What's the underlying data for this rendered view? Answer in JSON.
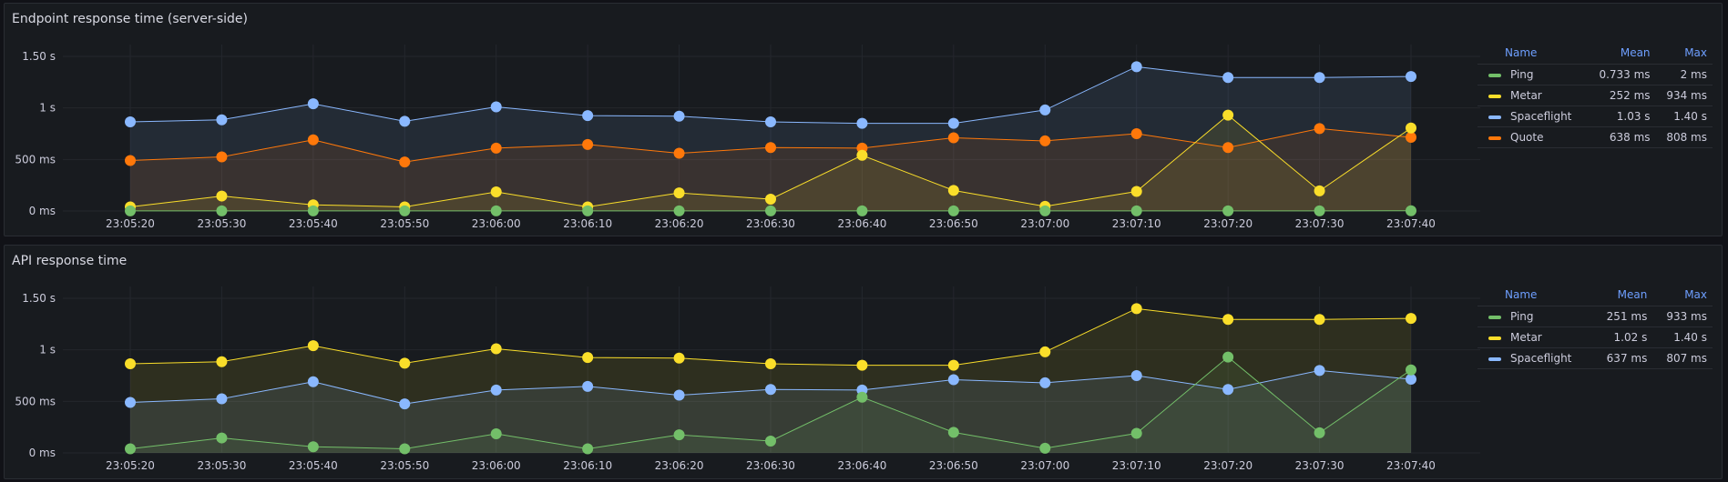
{
  "panels": [
    {
      "title": "Endpoint response time (server-side)",
      "legend_headers": {
        "name": "Name",
        "mean": "Mean",
        "max": "Max"
      },
      "legend": [
        {
          "name": "Ping",
          "mean": "0.733 ms",
          "max": "2 ms",
          "color": "#73bf69"
        },
        {
          "name": "Metar",
          "mean": "252 ms",
          "max": "934 ms",
          "color": "#fade2a"
        },
        {
          "name": "Spaceflight",
          "mean": "1.03 s",
          "max": "1.40 s",
          "color": "#8ab8ff"
        },
        {
          "name": "Quote",
          "mean": "638 ms",
          "max": "808 ms",
          "color": "#ff780a"
        }
      ]
    },
    {
      "title": "API response time",
      "legend_headers": {
        "name": "Name",
        "mean": "Mean",
        "max": "Max"
      },
      "legend": [
        {
          "name": "Ping",
          "mean": "251 ms",
          "max": "933 ms",
          "color": "#73bf69"
        },
        {
          "name": "Metar",
          "mean": "1.02 s",
          "max": "1.40 s",
          "color": "#fade2a"
        },
        {
          "name": "Spaceflight",
          "mean": "637 ms",
          "max": "807 ms",
          "color": "#8ab8ff"
        }
      ]
    }
  ],
  "chart_data": [
    {
      "type": "area",
      "title": "Endpoint response time (server-side)",
      "x": [
        "23:05:20",
        "23:05:30",
        "23:05:40",
        "23:05:50",
        "23:06:00",
        "23:06:10",
        "23:06:20",
        "23:06:30",
        "23:06:40",
        "23:06:50",
        "23:07:00",
        "23:07:10",
        "23:07:20",
        "23:07:30",
        "23:07:40"
      ],
      "y_ticks": [
        "0 ms",
        "500 ms",
        "1 s",
        "1.50 s"
      ],
      "y_tick_values": [
        0,
        500,
        1000,
        1500
      ],
      "ylim": [
        0,
        1500
      ],
      "unit": "ms",
      "series": [
        {
          "name": "Spaceflight",
          "color": "#8ab8ff",
          "values": [
            865,
            885,
            1040,
            870,
            1010,
            925,
            920,
            865,
            850,
            850,
            980,
            1400,
            1295,
            1295,
            1305
          ]
        },
        {
          "name": "Quote",
          "color": "#ff780a",
          "values": [
            490,
            525,
            690,
            475,
            610,
            645,
            560,
            615,
            610,
            710,
            680,
            750,
            615,
            800,
            715
          ]
        },
        {
          "name": "Metar",
          "color": "#fade2a",
          "values": [
            40,
            145,
            60,
            40,
            185,
            40,
            175,
            115,
            540,
            200,
            45,
            190,
            930,
            195,
            805
          ]
        },
        {
          "name": "Ping",
          "color": "#73bf69",
          "values": [
            0.7,
            0.7,
            0.7,
            0.7,
            0.7,
            0.7,
            0.7,
            0.7,
            0.7,
            0.7,
            0.7,
            0.7,
            0.7,
            0.7,
            2
          ]
        }
      ]
    },
    {
      "type": "area",
      "title": "API response time",
      "x": [
        "23:05:20",
        "23:05:30",
        "23:05:40",
        "23:05:50",
        "23:06:00",
        "23:06:10",
        "23:06:20",
        "23:06:30",
        "23:06:40",
        "23:06:50",
        "23:07:00",
        "23:07:10",
        "23:07:20",
        "23:07:30",
        "23:07:40"
      ],
      "y_ticks": [
        "0 ms",
        "500 ms",
        "1 s",
        "1.50 s"
      ],
      "y_tick_values": [
        0,
        500,
        1000,
        1500
      ],
      "ylim": [
        0,
        1500
      ],
      "unit": "ms",
      "series": [
        {
          "name": "Metar",
          "color": "#fade2a",
          "values": [
            865,
            885,
            1040,
            870,
            1010,
            925,
            920,
            865,
            850,
            850,
            980,
            1400,
            1295,
            1295,
            1305
          ]
        },
        {
          "name": "Spaceflight",
          "color": "#8ab8ff",
          "values": [
            490,
            525,
            690,
            475,
            610,
            645,
            560,
            615,
            610,
            710,
            680,
            750,
            615,
            800,
            715
          ]
        },
        {
          "name": "Ping",
          "color": "#73bf69",
          "values": [
            40,
            145,
            60,
            40,
            185,
            40,
            175,
            115,
            540,
            200,
            45,
            190,
            930,
            195,
            805
          ]
        }
      ]
    }
  ]
}
